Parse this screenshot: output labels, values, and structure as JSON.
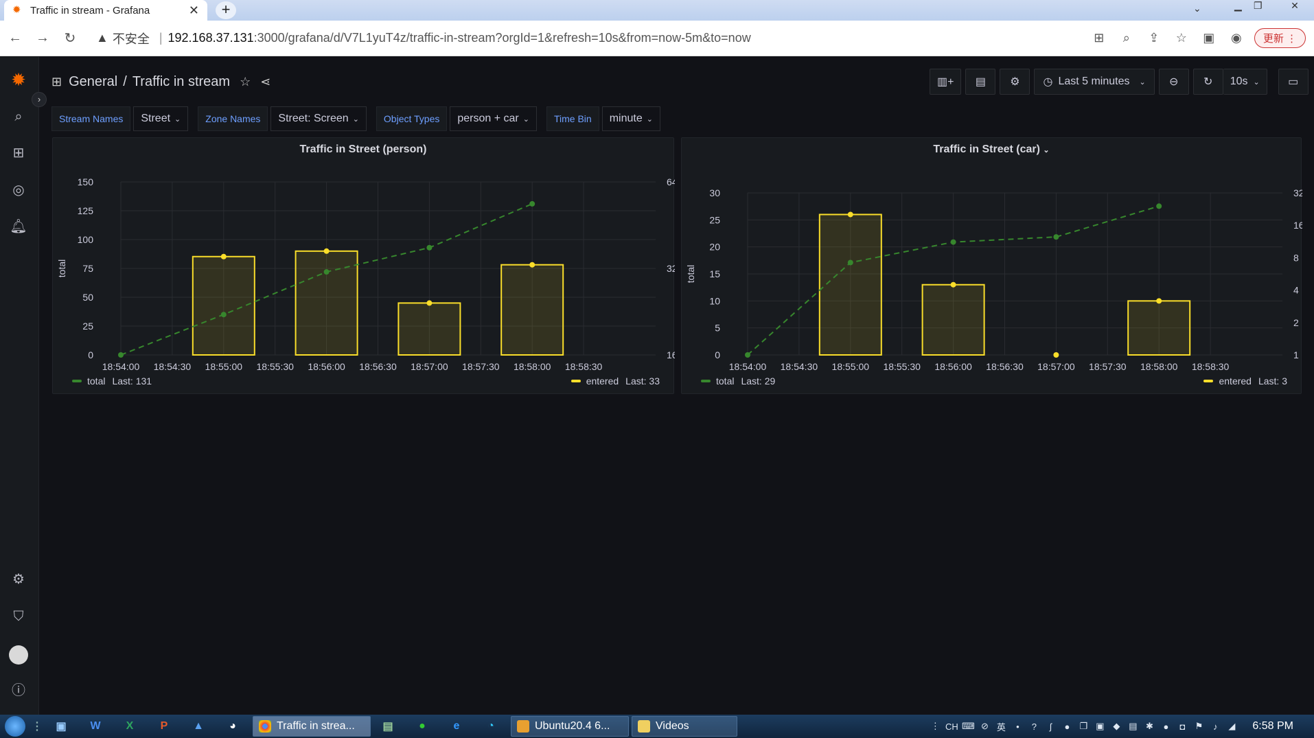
{
  "browser": {
    "tab_title": "Traffic in stream - Grafana",
    "url_insecure": "不安全",
    "url_host": "192.168.37.131",
    "url_path": ":3000/grafana/d/V7L1yuT4z/traffic-in-stream?orgId=1&refresh=10s&from=now-5m&to=now",
    "update_label": "更新"
  },
  "header": {
    "folder": "General",
    "dashboard": "Traffic in stream",
    "time_range": "Last 5 minutes",
    "refresh": "10s"
  },
  "variables": [
    {
      "label": "Stream Names",
      "value": "Street"
    },
    {
      "label": "Zone Names",
      "value": "Street: Screen"
    },
    {
      "label": "Object Types",
      "value": "person + car"
    },
    {
      "label": "Time Bin",
      "value": "minute"
    }
  ],
  "chart_data": [
    {
      "type": "bar",
      "title": "Traffic in Street (person)",
      "x_ticks": [
        "18:54:00",
        "18:54:30",
        "18:55:00",
        "18:55:30",
        "18:56:00",
        "18:56:30",
        "18:57:00",
        "18:57:30",
        "18:58:00",
        "18:58:30"
      ],
      "ylabel": "total",
      "y2label": "entered",
      "y_ticks": [
        "150",
        "125",
        "100",
        "75",
        "50",
        "25",
        "0"
      ],
      "y2_ticks": [
        "64",
        "32",
        "16"
      ],
      "series": [
        {
          "name": "total",
          "type": "line",
          "color": "#37872d",
          "x": [
            "18:54:00",
            "18:55:00",
            "18:56:00",
            "18:57:00",
            "18:58:00"
          ],
          "values": [
            0,
            35,
            72,
            93,
            131
          ]
        },
        {
          "name": "entered",
          "type": "bar",
          "color": "#fade2a",
          "x": [
            "18:55:00",
            "18:56:00",
            "18:57:00",
            "18:58:00"
          ],
          "values": [
            36,
            38,
            19,
            33
          ]
        }
      ],
      "legend": [
        {
          "name": "total",
          "last": "Last: 131",
          "color": "#37872d"
        },
        {
          "name": "entered",
          "last": "Last: 33",
          "color": "#fade2a"
        }
      ]
    },
    {
      "type": "bar",
      "title": "Traffic in Street (car)",
      "x_ticks": [
        "18:54:00",
        "18:54:30",
        "18:55:00",
        "18:55:30",
        "18:56:00",
        "18:56:30",
        "18:57:00",
        "18:57:30",
        "18:58:00",
        "18:58:30"
      ],
      "ylabel": "total",
      "y2label": "entered",
      "y_ticks": [
        "30",
        "25",
        "20",
        "15",
        "10",
        "5",
        "0"
      ],
      "y2_ticks": [
        "32",
        "16",
        "8",
        "4",
        "2",
        "1"
      ],
      "series": [
        {
          "name": "total",
          "type": "line",
          "color": "#37872d",
          "x": [
            "18:54:00",
            "18:55:00",
            "18:56:00",
            "18:57:00",
            "18:58:00"
          ],
          "values": [
            0,
            18,
            22,
            23,
            29
          ]
        },
        {
          "name": "entered",
          "type": "bar",
          "color": "#fade2a",
          "x": [
            "18:55:00",
            "18:56:00",
            "18:57:00",
            "18:58:00"
          ],
          "values": [
            26,
            13,
            0,
            10
          ]
        }
      ],
      "legend": [
        {
          "name": "total",
          "last": "Last: 29",
          "color": "#37872d"
        },
        {
          "name": "entered",
          "last": "Last: 3",
          "color": "#fade2a"
        }
      ]
    }
  ],
  "taskbar": {
    "tasks": [
      "Traffic in strea...",
      "Ubuntu20.4 6...",
      "Videos"
    ],
    "clock": "6:58 PM",
    "lang": "CH"
  }
}
